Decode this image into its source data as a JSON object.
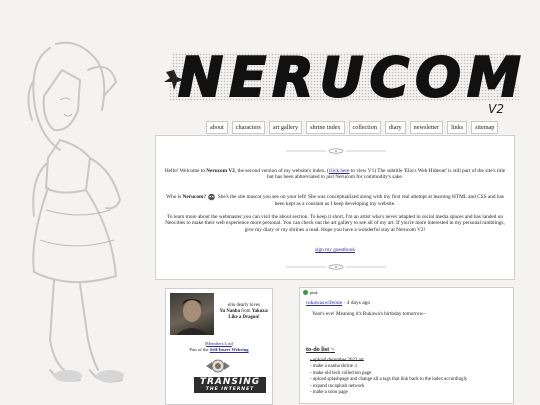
{
  "logo": {
    "text": "NERUCOM",
    "sub": "V2"
  },
  "nav": [
    "about",
    "characters",
    "art gallery",
    "shrine index",
    "collection",
    "diary",
    "newsletter",
    "links",
    "sitemap"
  ],
  "intro": {
    "p1a": "Hello! Welcome to ",
    "p1b": "Nerucom V2",
    "p1c": ", the second version of my website's index. (",
    "p1link": "click here",
    "p1d": " to view V1) The subtitle 'Elio's Web Hideout' is still part of the site's title but has been abbreviated to just Nerucom for commodity's sake.",
    "p2a": "Who is ",
    "p2b": "Nerucom?",
    "p2c": " She's the site mascot you see on your left! She was conceptualized along with my first real attempt at learning HTML and CSS and has been kept as a constant as I keep developing my website.",
    "p3": "To learn more about the webmaster you can visit the about section. To keep it short, I'm an artist who's never adapted in social media spaces and has landed on Neocities to make their web experience more personal. You can check out the art gallery to see all of my art. If you're more interested in my personal ramblings, give my diary or my shrines a read. Hope you have a wonderful stay at Nerucom V2!",
    "guestbook": "sign my guestbook"
  },
  "left": {
    "fav1": "elio dearly loves",
    "fav2": "Yu Nanba",
    "fav3": " from ",
    "fav4": "Yakuza: Like a Dragon!",
    "members": "Members List",
    "partof": "Part of the ",
    "webring": "Self-Insert Webring",
    "badge_big": "TRANSING",
    "badge_small": "THE INTERNET"
  },
  "status": {
    "tag": "pink",
    "user": "rukawaswifeone",
    "time": "4 days ago",
    "text": "Year's eve! Meaning it's Rukawa's birthday tomorrow~"
  },
  "todo": {
    "title": "to-do list",
    "items": [
      {
        "text": "- upload december 2023 art",
        "done": true
      },
      {
        "text": "- make a nanba shrine :c",
        "done": false
      },
      {
        "text": "- make old tech collection page",
        "done": false
      },
      {
        "text": "- upload splashpage and change all a tags that link back to the index accordingly",
        "done": false
      },
      {
        "text": "- expand rucaplush network",
        "done": false
      },
      {
        "text": "- make a sonu page",
        "done": false
      }
    ]
  },
  "colors": {
    "link": "#2a2aa8",
    "panel": "#ffffff",
    "bg": "#f4f3f1",
    "status_dot": "#3a9a3a"
  }
}
